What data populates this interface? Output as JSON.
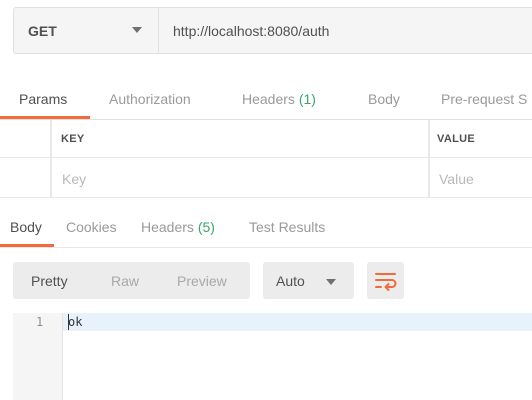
{
  "request": {
    "method": "GET",
    "url": "http://localhost:8080/auth"
  },
  "request_tabs": {
    "params": "Params",
    "authorization": "Authorization",
    "headers": "Headers",
    "headers_count": "(1)",
    "body": "Body",
    "prerequest": "Pre-request S"
  },
  "params_table": {
    "key_header": "KEY",
    "value_header": "VALUE",
    "key_placeholder": "Key",
    "value_placeholder": "Value"
  },
  "response_tabs": {
    "body": "Body",
    "cookies": "Cookies",
    "headers": "Headers",
    "headers_count": "(5)",
    "test_results": "Test Results"
  },
  "response_view": {
    "pretty": "Pretty",
    "raw": "Raw",
    "preview": "Preview",
    "format": "Auto"
  },
  "response_body": {
    "line_number": "1",
    "text": "ok"
  },
  "colors": {
    "accent": "#f26b3a",
    "count_green": "#3aa769"
  }
}
